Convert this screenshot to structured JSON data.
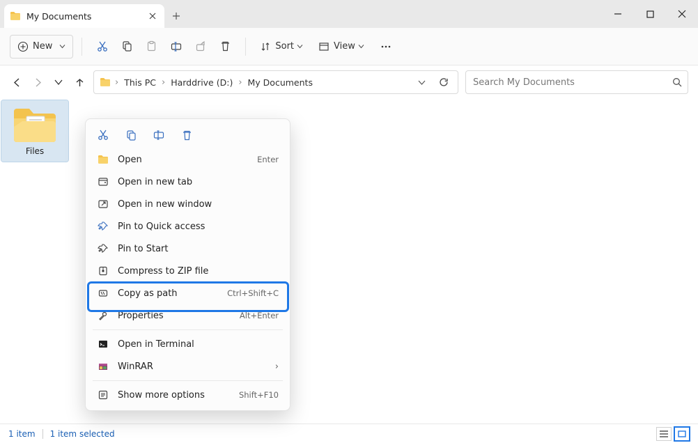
{
  "window": {
    "title": "My Documents"
  },
  "toolbar": {
    "new": "New",
    "sort": "Sort",
    "view": "View"
  },
  "breadcrumb": {
    "items": [
      "This PC",
      "Harddrive (D:)",
      "My Documents"
    ]
  },
  "search": {
    "placeholder": "Search My Documents"
  },
  "content": {
    "items": [
      {
        "name": "Files",
        "type": "folder",
        "selected": true
      }
    ]
  },
  "context_menu": {
    "quick": [
      "cut",
      "copy",
      "rename",
      "delete"
    ],
    "items": [
      {
        "icon": "folder",
        "label": "Open",
        "shortcut": "Enter"
      },
      {
        "icon": "open-tab",
        "label": "Open in new tab"
      },
      {
        "icon": "open-window",
        "label": "Open in new window"
      },
      {
        "icon": "pin",
        "label": "Pin to Quick access"
      },
      {
        "icon": "pin",
        "label": "Pin to Start"
      },
      {
        "icon": "zip",
        "label": "Compress to ZIP file"
      },
      {
        "icon": "copy-path",
        "label": "Copy as path",
        "shortcut": "Ctrl+Shift+C",
        "highlighted": true
      },
      {
        "icon": "properties",
        "label": "Properties",
        "shortcut": "Alt+Enter"
      },
      {
        "sep": true
      },
      {
        "icon": "terminal",
        "label": "Open in Terminal"
      },
      {
        "icon": "winrar",
        "label": "WinRAR",
        "submenu": true
      },
      {
        "sep": true
      },
      {
        "icon": "more",
        "label": "Show more options",
        "shortcut": "Shift+F10"
      }
    ]
  },
  "statusbar": {
    "count": "1 item",
    "selected": "1 item selected"
  }
}
